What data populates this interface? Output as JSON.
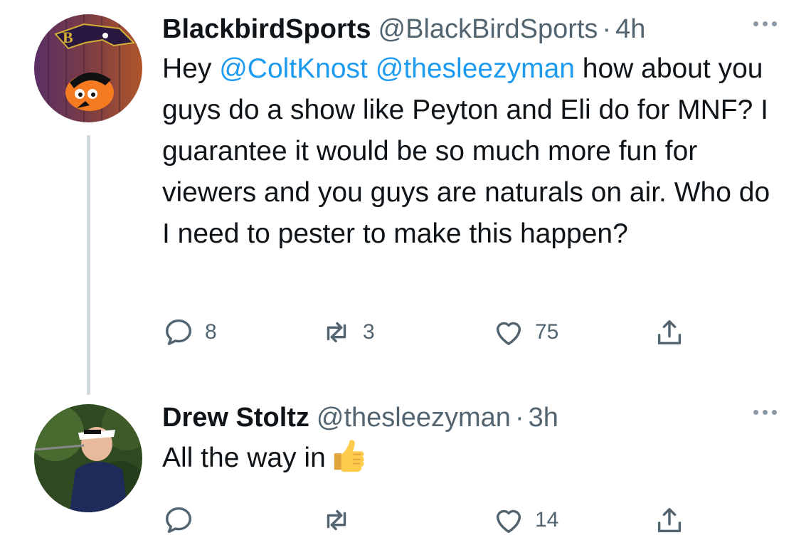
{
  "tweets": [
    {
      "display_name": "BlackbirdSports",
      "handle": "@BlackBirdSports",
      "separator": "·",
      "time": "4h",
      "text": {
        "prefix": "Hey ",
        "mention1": "@ColtKnost",
        "space": " ",
        "mention2": "@thesleezyman",
        "rest": " how about you guys do a show like Peyton and Eli do for MNF? I guarantee it would be so much more fun for viewers and you guys are naturals on air. Who do I need to pester to make this happen?"
      },
      "avatar_icon": "ravens-orioles-logo-avatar",
      "actions": {
        "reply": {
          "icon": "reply-icon",
          "count": "8"
        },
        "retweet": {
          "icon": "retweet-icon",
          "count": "3"
        },
        "like": {
          "icon": "heart-icon",
          "count": "75"
        },
        "share": {
          "icon": "share-icon"
        }
      }
    },
    {
      "display_name": "Drew Stoltz",
      "handle": "@thesleezyman",
      "separator": "·",
      "time": "3h",
      "text": {
        "main": "All the way in"
      },
      "emoji": "thumbs-up-emoji",
      "avatar_icon": "golfer-photo-avatar",
      "actions": {
        "reply": {
          "icon": "reply-icon",
          "count": ""
        },
        "retweet": {
          "icon": "retweet-icon",
          "count": ""
        },
        "like": {
          "icon": "heart-icon",
          "count": "14"
        },
        "share": {
          "icon": "share-icon"
        }
      }
    }
  ],
  "colors": {
    "text": "#0f1419",
    "secondary": "#536471",
    "mention": "#1d9bf0",
    "thread_line": "#cfd9de"
  }
}
